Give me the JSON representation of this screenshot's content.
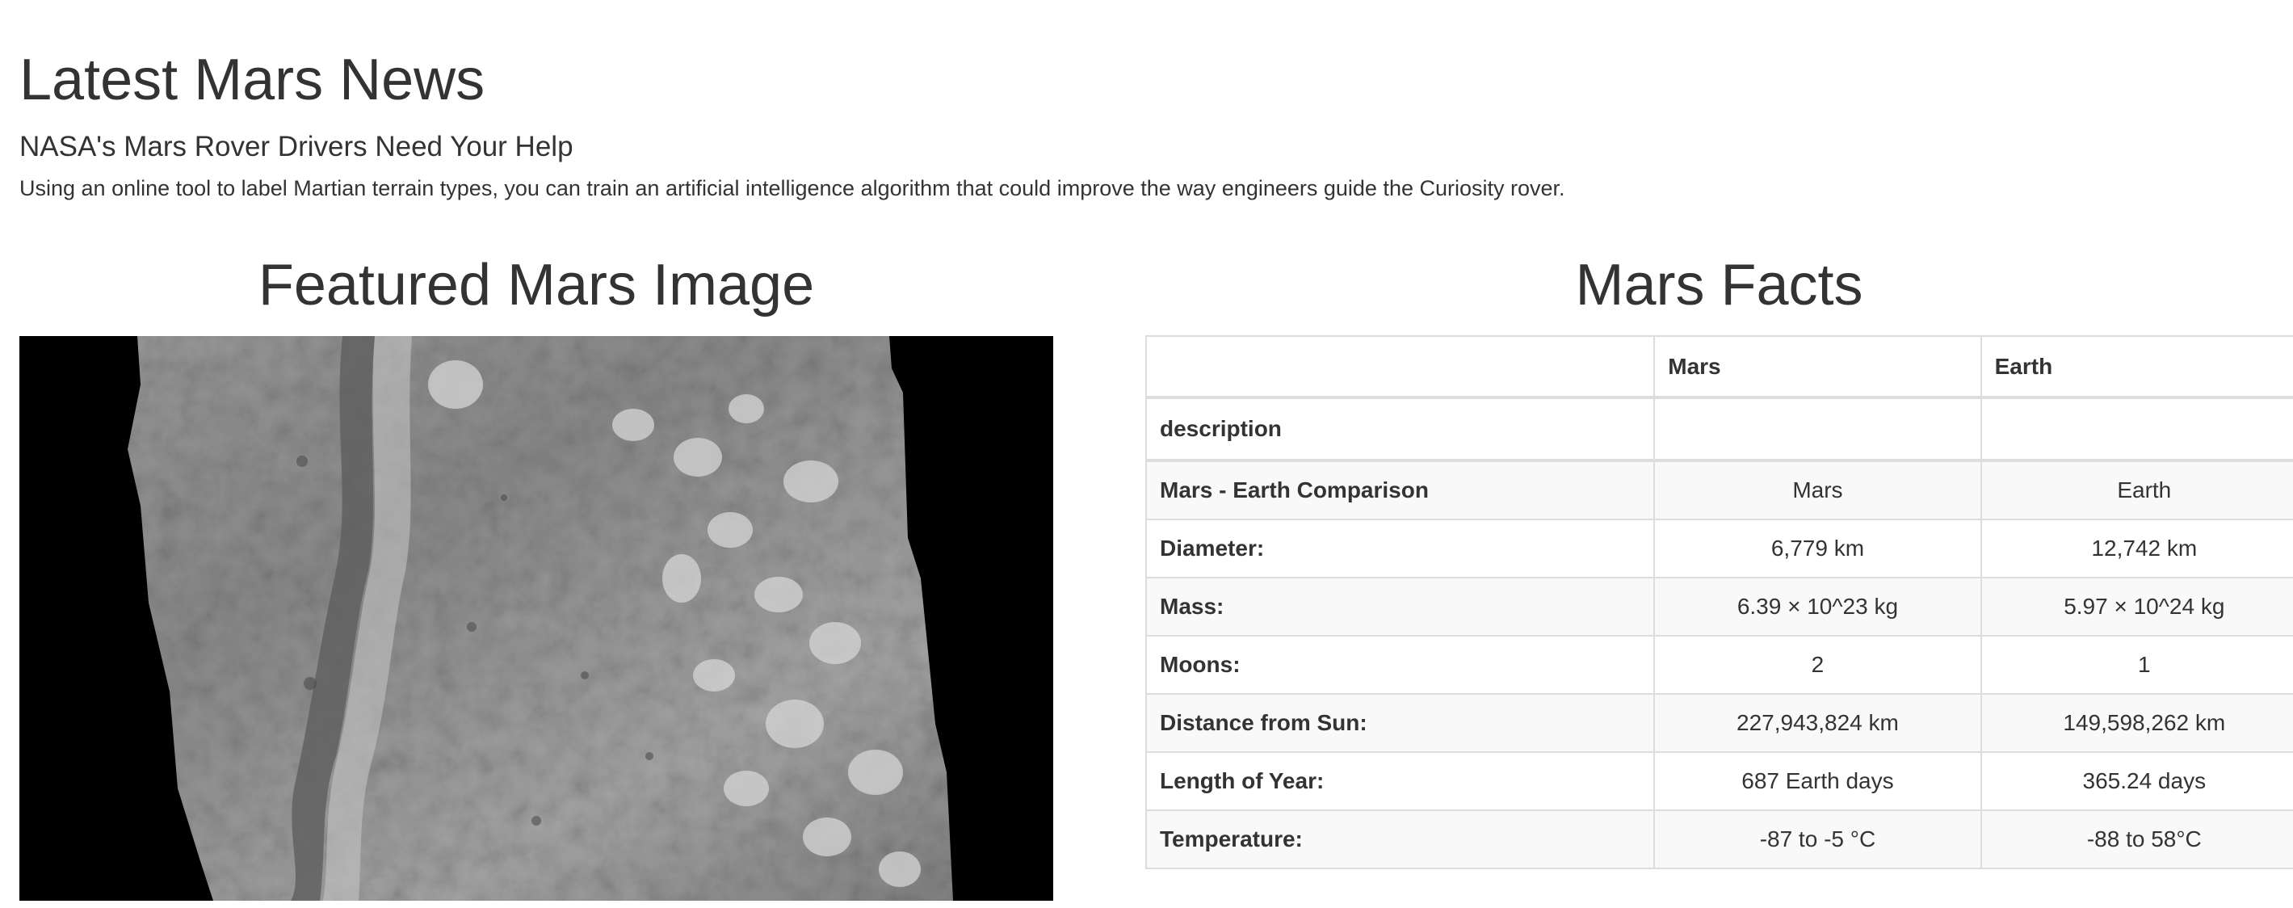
{
  "news": {
    "section_title": "Latest Mars News",
    "headline": "NASA's Mars Rover Drivers Need Your Help",
    "teaser": "Using an online tool to label Martian terrain types, you can train an artificial intelligence algorithm that could improve the way engineers guide the Curiosity rover."
  },
  "featured_image": {
    "section_title": "Featured Mars Image",
    "image_icon": "mars-terrain-grayscale-photo"
  },
  "facts": {
    "section_title": "Mars Facts",
    "columns": [
      "",
      "Mars",
      "Earth"
    ],
    "rows": [
      {
        "label": "description",
        "mars": "",
        "earth": ""
      },
      {
        "label": "Mars - Earth Comparison",
        "mars": "Mars",
        "earth": "Earth"
      },
      {
        "label": "Diameter:",
        "mars": "6,779 km",
        "earth": "12,742 km"
      },
      {
        "label": "Mass:",
        "mars": "6.39 × 10^23 kg",
        "earth": "5.97 × 10^24 kg"
      },
      {
        "label": "Moons:",
        "mars": "2",
        "earth": "1"
      },
      {
        "label": "Distance from Sun:",
        "mars": "227,943,824 km",
        "earth": "149,598,262 km"
      },
      {
        "label": "Length of Year:",
        "mars": "687 Earth days",
        "earth": "365.24 days"
      },
      {
        "label": "Temperature:",
        "mars": "-87 to -5 °C",
        "earth": "-88 to 58°C"
      }
    ]
  }
}
